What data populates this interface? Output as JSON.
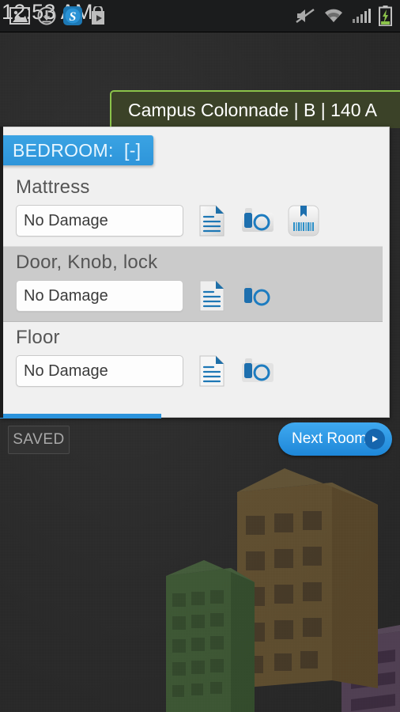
{
  "status_bar": {
    "time": "12:53 AM",
    "left_icons": [
      {
        "name": "gallery-icon",
        "label": "Gallery"
      },
      {
        "name": "download-icon",
        "label": "Download"
      },
      {
        "name": "skype-icon",
        "label": "S"
      },
      {
        "name": "play-store-icon",
        "label": "Play Store"
      }
    ],
    "right_icons": [
      {
        "name": "mute-icon",
        "label": "Muted"
      },
      {
        "name": "wifi-icon",
        "label": "Wi-Fi"
      },
      {
        "name": "cellular-signal-icon",
        "label": "Signal"
      },
      {
        "name": "battery-charging-icon",
        "label": "Charging"
      }
    ]
  },
  "header": {
    "room_title": "Campus Colonnade | B | 140 A",
    "accent_border": "#8bc34a",
    "background": "#3b4228"
  },
  "panel": {
    "section_tab": "BEDROOM:  [-]",
    "section_tab_color": "#2e95da",
    "rows": [
      {
        "label": "Mattress",
        "value": "No Damage",
        "placeholder": "No Damage",
        "highlighted": false,
        "icons": [
          "notes-icon",
          "camera-icon",
          "barcode-icon"
        ]
      },
      {
        "label": "Door, Knob, lock",
        "value": "No Damage",
        "placeholder": "No Damage",
        "highlighted": true,
        "icons": [
          "notes-icon",
          "camera-icon"
        ]
      },
      {
        "label": "Floor",
        "value": "No Damage",
        "placeholder": "No Damage",
        "highlighted": false,
        "icons": [
          "notes-icon",
          "camera-icon"
        ]
      }
    ],
    "scroll_progress_percent": 41
  },
  "footer": {
    "saved_label": "SAVED",
    "next_room_label": "Next Room",
    "next_room_color": "#2b93dc"
  }
}
